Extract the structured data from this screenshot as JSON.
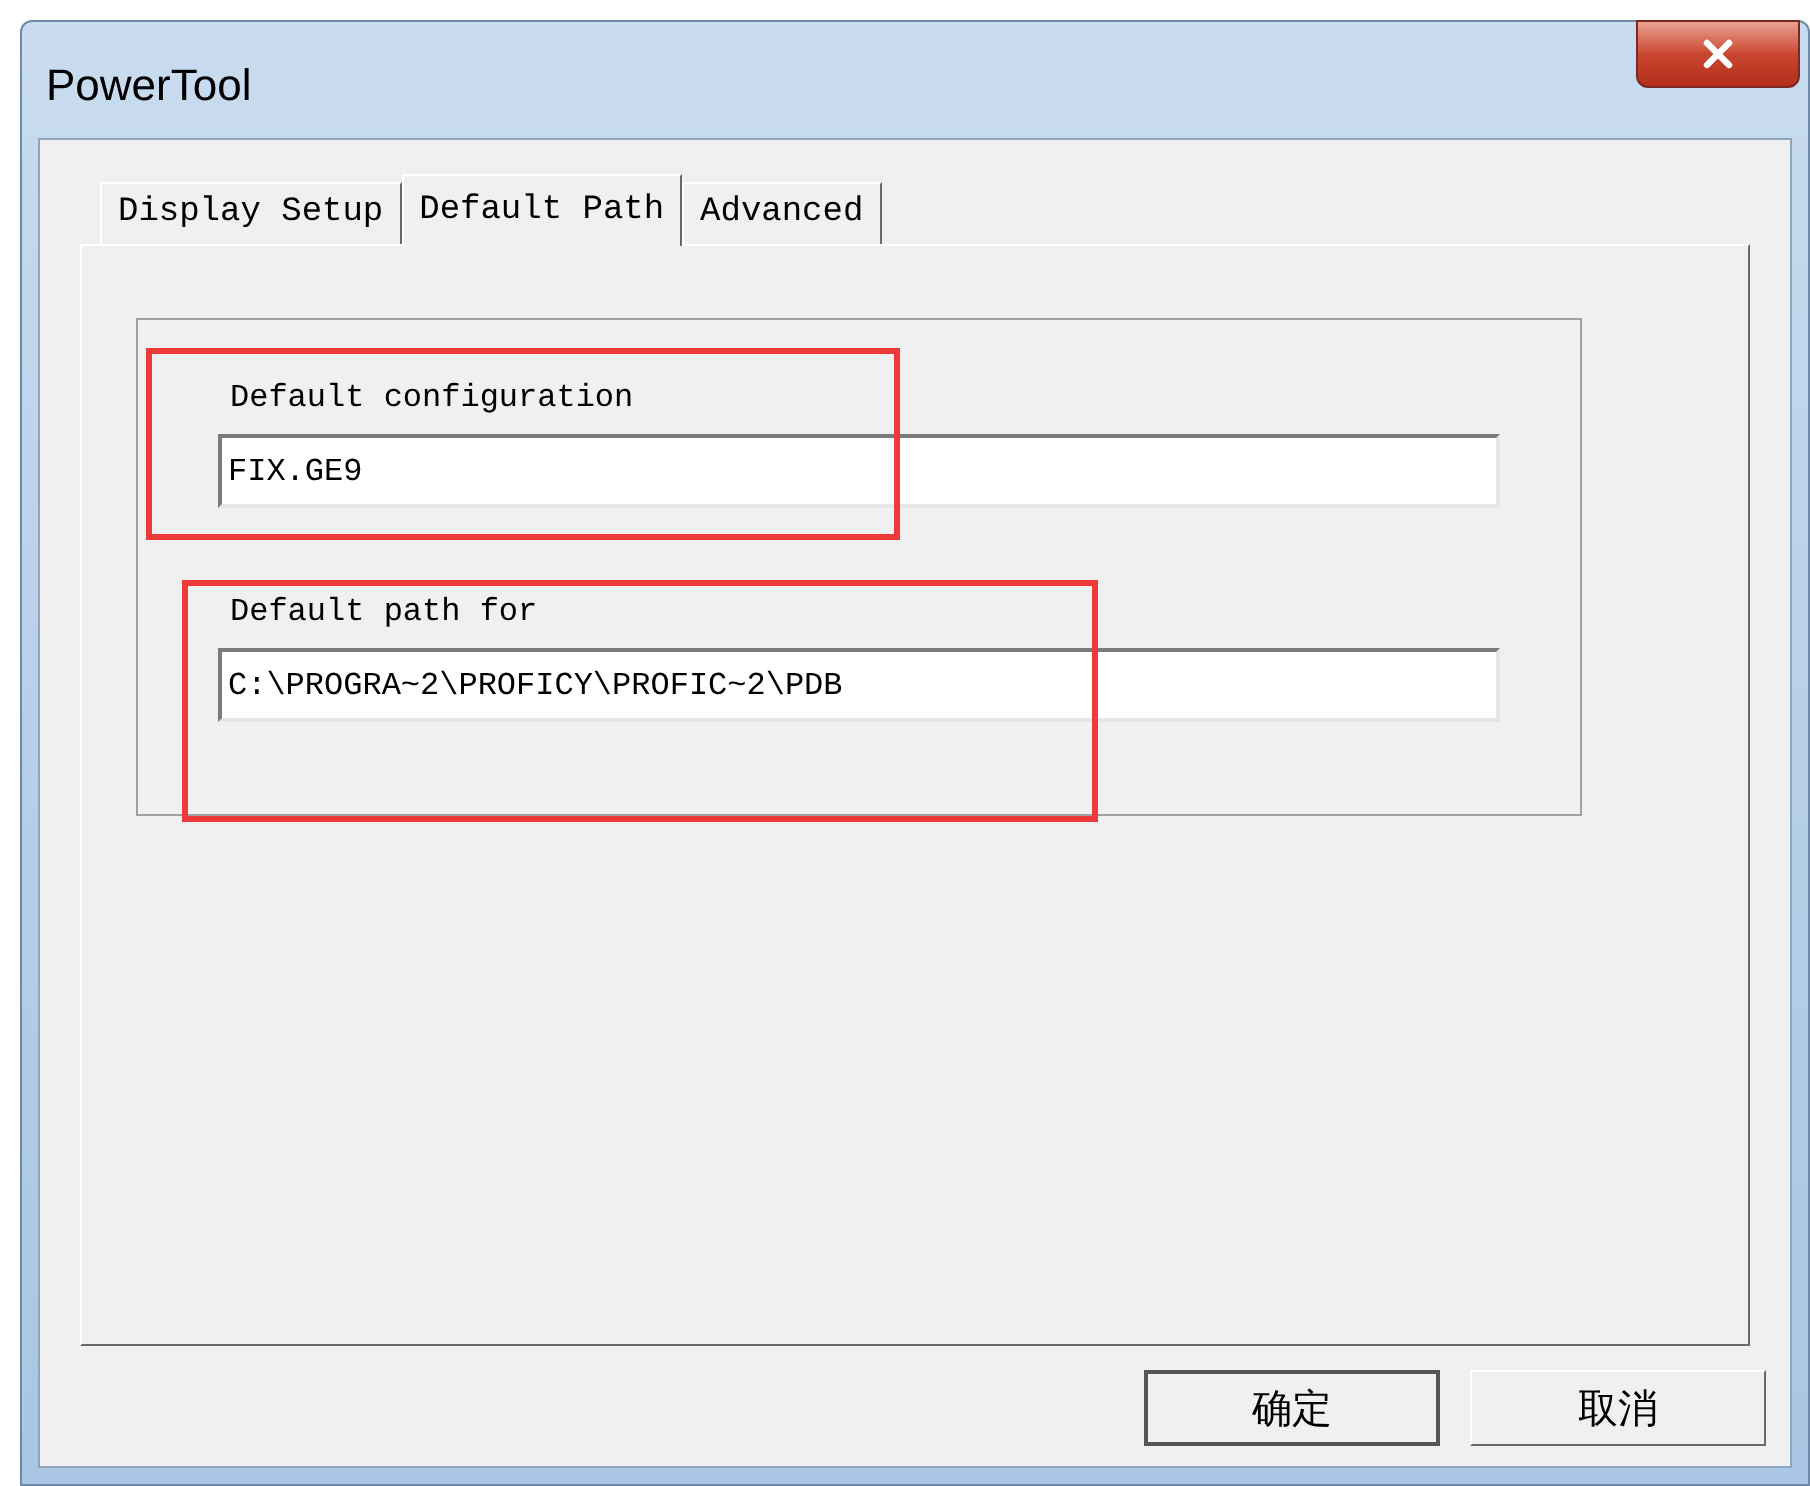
{
  "window": {
    "title": "PowerTool"
  },
  "tabs": [
    {
      "label": "Display Setup",
      "selected": false
    },
    {
      "label": "Default Path",
      "selected": true
    },
    {
      "label": "Advanced",
      "selected": false
    }
  ],
  "fields": [
    {
      "label": "Default configuration",
      "value": "FIX.GE9",
      "highlighted": true
    },
    {
      "label": "Default path for",
      "value": "C:\\PROGRA~2\\PROFICY\\PROFIC~2\\PDB",
      "highlighted": true
    }
  ],
  "buttons": [
    {
      "label": "确定",
      "default": true
    },
    {
      "label": "取消",
      "default": false
    }
  ]
}
